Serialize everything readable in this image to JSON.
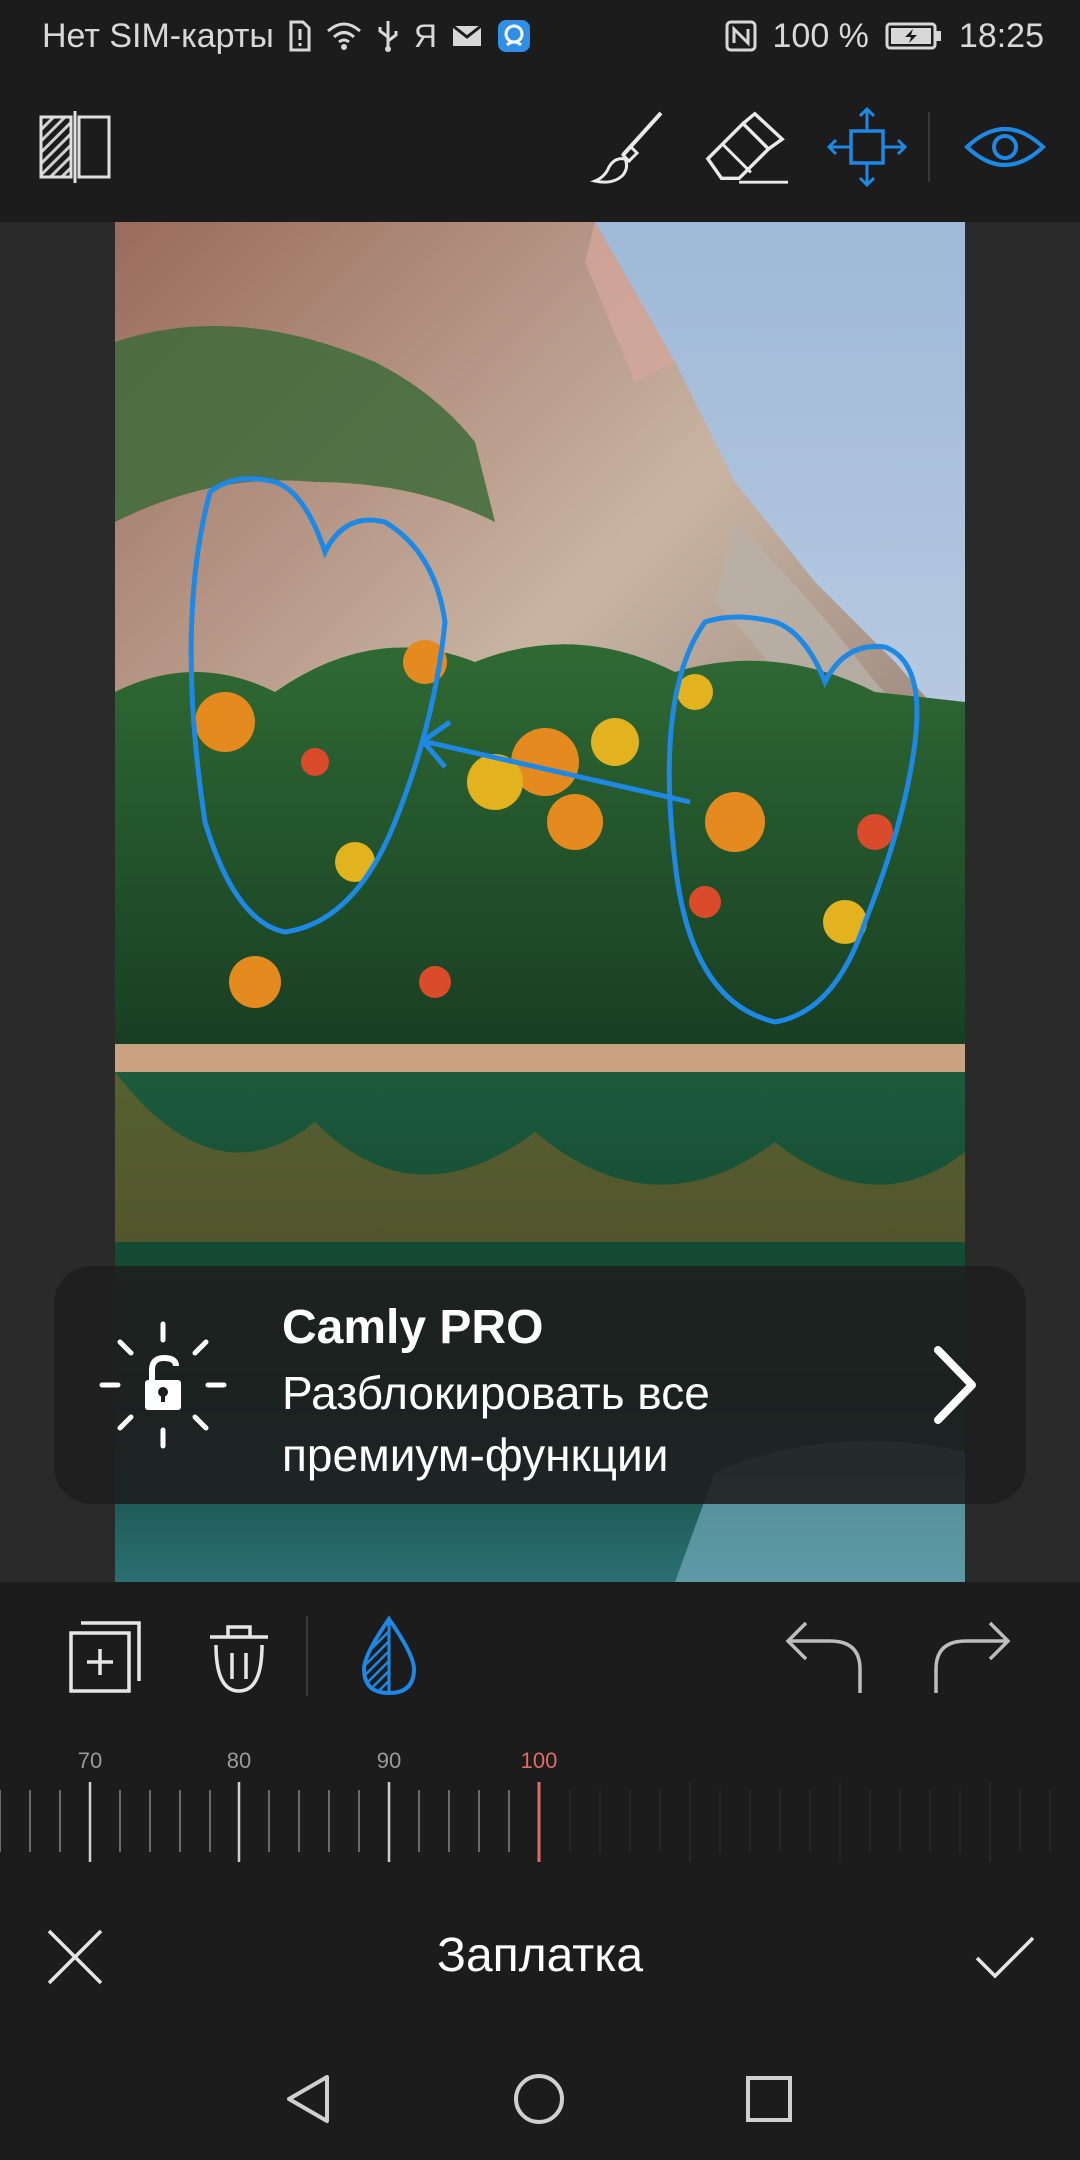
{
  "status_bar": {
    "carrier": "Нет SIM-карты",
    "battery": "100 %",
    "time": "18:25",
    "icons": [
      "sim-alert-icon",
      "wifi-icon",
      "usb-icon",
      "yandex-icon",
      "mail-icon",
      "app-notification-icon",
      "nfc-icon",
      "battery-icon"
    ]
  },
  "toolbar": {
    "items": [
      "compare-icon",
      "brush-icon",
      "eraser-icon",
      "move-icon",
      "eye-icon"
    ],
    "accent": "#1e88e5"
  },
  "promo": {
    "title": "Camly PRO",
    "text": "Разблокировать все премиум-функции"
  },
  "bottom_tools": {
    "items": [
      "add-layer-icon",
      "delete-icon",
      "opacity-icon",
      "undo-icon",
      "redo-icon"
    ]
  },
  "slider": {
    "labels": [
      "70",
      "80",
      "90",
      "100"
    ],
    "value": 100,
    "active_color": "#e06a6a"
  },
  "screen": {
    "title": "Заплатка"
  }
}
